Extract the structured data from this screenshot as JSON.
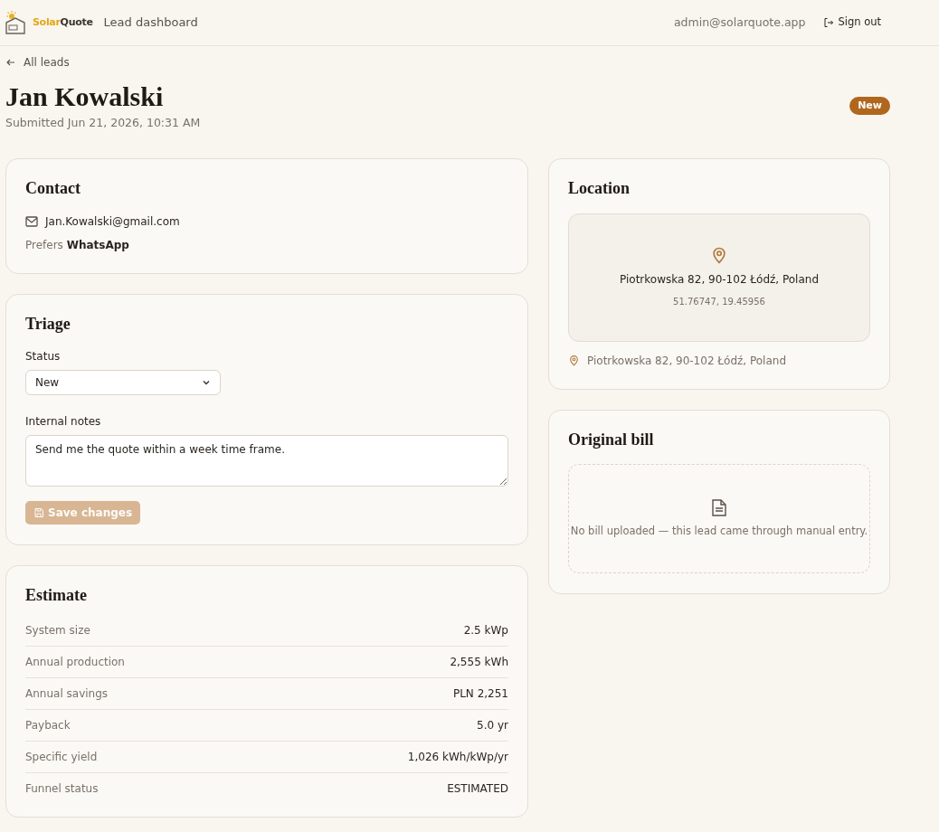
{
  "navbar": {
    "brand": {
      "first": "Solar",
      "second": "Quote"
    },
    "title": "Lead dashboard",
    "user": "admin@solarquote.app",
    "sign_out": "Sign out"
  },
  "back_link": "All leads",
  "lead": {
    "name": "Jan Kowalski",
    "submitted": "Submitted Jun 21, 2026, 10:31 AM",
    "badge": "New"
  },
  "contact": {
    "title": "Contact",
    "email": "Jan.Kowalski@gmail.com",
    "preference": "Prefers **WhatsApp**"
  },
  "triage": {
    "title": "Triage",
    "status_label": "Status",
    "status_value": "New",
    "notes_label": "Internal notes",
    "notes_value": "Send me the quote within a week time frame.",
    "save_button": {
      "label": "Save changes",
      "disabled": true
    }
  },
  "estimate": {
    "title": "Estimate",
    "rows": [
      {
        "label": "System size",
        "value": "2.5 kWp"
      },
      {
        "label": "Annual production",
        "value": "2,555 kWh"
      },
      {
        "label": "Annual savings",
        "value": "PLN 2,251"
      },
      {
        "label": "Payback",
        "value": "5.0 yr"
      },
      {
        "label": "Specific yield",
        "value": "1,026 kWh/kWp/yr"
      },
      {
        "label": "Funnel status",
        "value": "ESTIMATED"
      }
    ]
  },
  "location": {
    "title": "Location",
    "map_address": "Piotrkowska 82, 90-102 Łódź, Poland",
    "coordinates": "51.76747, 19.45956",
    "address": "Piotrkowska 82, 90-102 Łódź, Poland"
  },
  "original_bill": {
    "title": "Original bill",
    "message": "No bill uploaded — this lead came through manual entry."
  }
}
